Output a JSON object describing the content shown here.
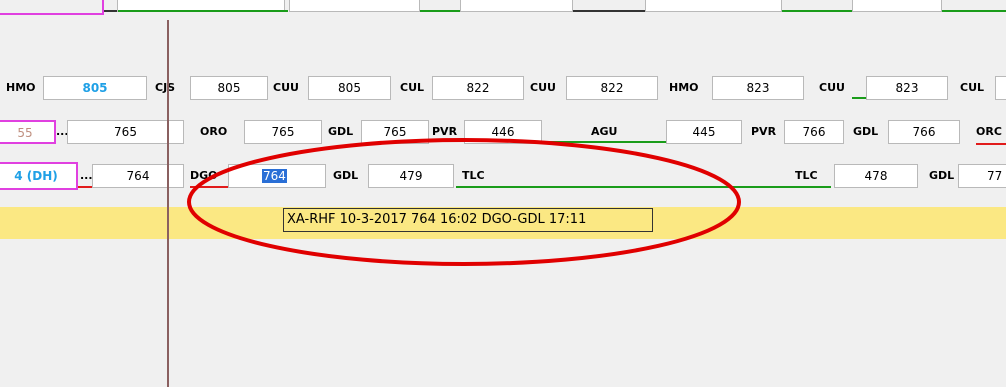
{
  "row1": {
    "items": [
      {
        "code": "HMO",
        "flight": "805"
      },
      {
        "code": "CJS",
        "flight": "805"
      },
      {
        "code": "CUU",
        "flight": "805"
      },
      {
        "code": "CUL",
        "flight": "822"
      },
      {
        "code": "CUU",
        "flight": "822"
      },
      {
        "code": "HMO",
        "flight": "823"
      },
      {
        "code": "CUU",
        "flight": "823"
      },
      {
        "code": "CUL",
        "flight": ""
      }
    ]
  },
  "row2": {
    "first": "55",
    "ellipsis": "...",
    "items": [
      {
        "code": "ORO",
        "flight": "765"
      },
      {
        "code": "GDL",
        "flight": "765"
      },
      {
        "code": "PVR",
        "flight": "765"
      },
      {
        "code": "AGU",
        "flight": "446"
      },
      {
        "code": "PVR",
        "flight": "445"
      },
      {
        "code": "GDL",
        "flight": "766"
      },
      {
        "code": "ORC",
        "flight": "766"
      }
    ]
  },
  "row3": {
    "first": "4 (DH)",
    "ellipsis": "...",
    "items": [
      {
        "code": "DGO",
        "flight": "764"
      },
      {
        "code": "GDL",
        "flight": "764"
      },
      {
        "code": "TLC",
        "flight": "479"
      },
      {
        "code": "TLC",
        "flight": ""
      },
      {
        "code": "GDL",
        "flight": "478"
      },
      {
        "code": "",
        "flight": "77"
      }
    ]
  },
  "tooltip": {
    "text": "XA-RHF  10-3-2017  764  16:02 DGO-GDL 17:11"
  },
  "colors": {
    "line_green": "#1a9c1a",
    "line_red": "#e11b1b",
    "tooltip_band": "#fbe883",
    "annotation_ellipse": "#e00000",
    "selection": "#2a6fd6",
    "highlight_text": "#1fa0e6",
    "magenta_border": "#e040e0"
  }
}
